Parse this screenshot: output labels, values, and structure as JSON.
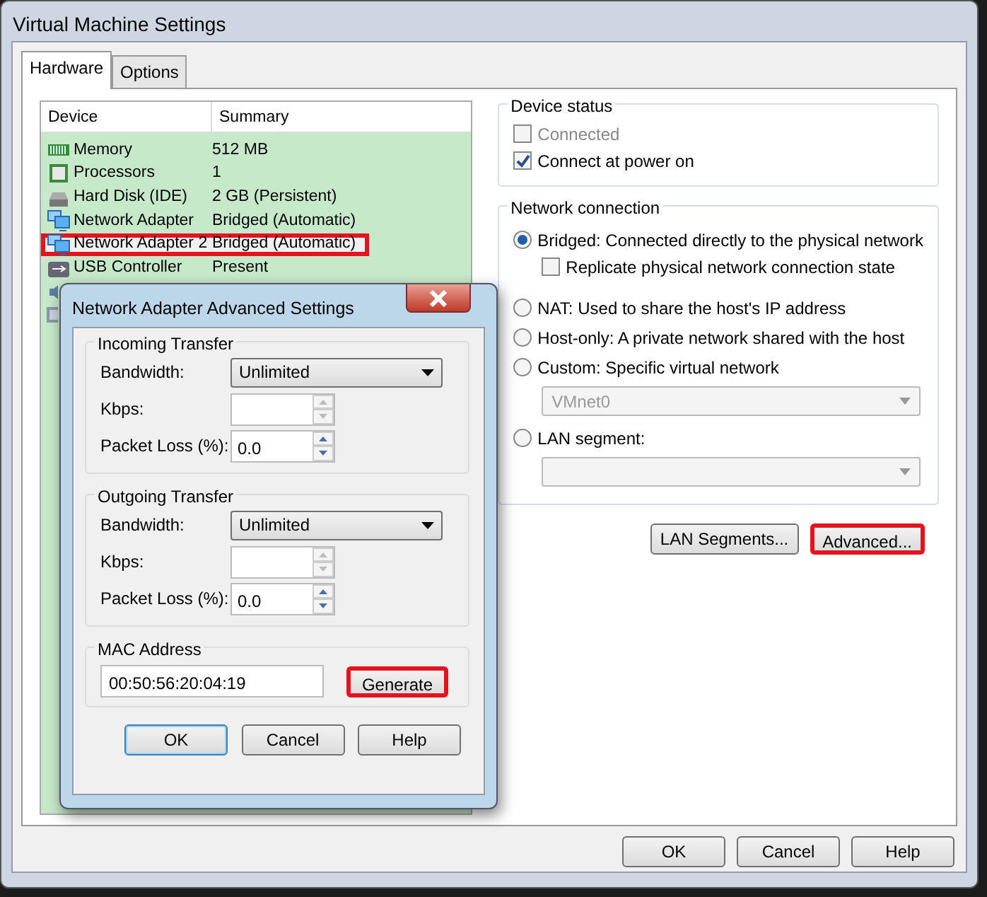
{
  "window": {
    "title": "Virtual Machine Settings"
  },
  "tabs": [
    {
      "label": "Hardware",
      "selected": true
    },
    {
      "label": "Options",
      "selected": false
    }
  ],
  "device_table": {
    "columns": [
      "Device",
      "Summary"
    ],
    "rows": [
      {
        "kind": "memory",
        "device": "Memory",
        "summary": "512 MB",
        "selected": false,
        "highlighted": false
      },
      {
        "kind": "processor",
        "device": "Processors",
        "summary": "1",
        "selected": false,
        "highlighted": false
      },
      {
        "kind": "disk",
        "device": "Hard Disk (IDE)",
        "summary": "2 GB (Persistent)",
        "selected": false,
        "highlighted": false
      },
      {
        "kind": "network",
        "device": "Network Adapter",
        "summary": "Bridged (Automatic)",
        "selected": false,
        "highlighted": false
      },
      {
        "kind": "network",
        "device": "Network Adapter 2",
        "summary": "Bridged (Automatic)",
        "selected": true,
        "highlighted": true
      },
      {
        "kind": "usb",
        "device": "USB Controller",
        "summary": "Present",
        "selected": false,
        "highlighted": false
      },
      {
        "kind": "speaker",
        "selected": false,
        "highlighted": false
      },
      {
        "kind": "display",
        "selected": false,
        "highlighted": false
      }
    ]
  },
  "device_status": {
    "title": "Device status",
    "options": [
      {
        "label": "Connected",
        "checked": false,
        "disabled": true
      },
      {
        "label": "Connect at power on",
        "checked": true,
        "disabled": false
      }
    ]
  },
  "network_connection": {
    "title": "Network connection",
    "options": [
      {
        "kind": "radio",
        "label": "Bridged: Connected directly to the physical network",
        "selected": true
      },
      {
        "kind": "checkbox",
        "label": "Replicate physical network connection state",
        "checked": false
      },
      {
        "kind": "radio",
        "label": "NAT: Used to share the host's IP address",
        "selected": false
      },
      {
        "kind": "radio",
        "label": "Host-only: A private network shared with the host",
        "selected": false
      },
      {
        "kind": "radio",
        "label": "Custom: Specific virtual network",
        "selected": false
      },
      {
        "kind": "dropdown",
        "value": "VMnet0",
        "disabled": true
      },
      {
        "kind": "radio",
        "label": "LAN segment:",
        "selected": false
      },
      {
        "kind": "dropdown",
        "disabled": true
      }
    ]
  },
  "panel_buttons": [
    {
      "label": "LAN Segments...",
      "highlighted": false
    },
    {
      "label": "Advanced...",
      "highlighted": true
    }
  ],
  "dialog_buttons": [
    {
      "label": "OK"
    },
    {
      "label": "Cancel"
    },
    {
      "label": "Help"
    }
  ],
  "advanced_dialog": {
    "title": "Network Adapter Advanced Settings",
    "sections": [
      {
        "title": "Incoming Transfer",
        "fields": [
          {
            "kind": "dropdown",
            "label": "Bandwidth:",
            "value": "Unlimited"
          },
          {
            "kind": "spinner",
            "label": "Kbps:",
            "disabled": true
          },
          {
            "kind": "spinner",
            "label": "Packet Loss (%):",
            "value": "0.0",
            "disabled": false
          }
        ]
      },
      {
        "title": "Outgoing Transfer",
        "fields": [
          {
            "kind": "dropdown",
            "label": "Bandwidth:",
            "value": "Unlimited"
          },
          {
            "kind": "spinner",
            "label": "Kbps:",
            "disabled": true
          },
          {
            "kind": "spinner",
            "label": "Packet Loss (%):",
            "value": "0.0",
            "disabled": false
          }
        ]
      }
    ],
    "mac": {
      "title": "MAC Address",
      "value": "00:50:56:20:04:19",
      "button": {
        "label": "Generate",
        "highlighted": true
      }
    },
    "buttons": [
      {
        "label": "OK",
        "default": true
      },
      {
        "label": "Cancel",
        "default": false
      },
      {
        "label": "Help",
        "default": false
      }
    ]
  }
}
